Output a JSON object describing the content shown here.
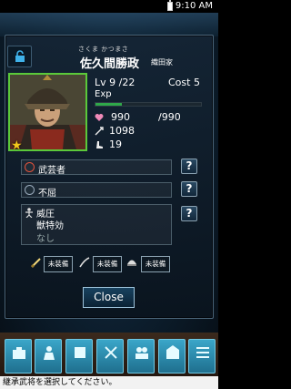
{
  "status_bar": {
    "time": "9:10 AM"
  },
  "general": {
    "furigana": "さくま かつまさ",
    "name": "佐久間勝政",
    "clan": "織田家",
    "level_label": "Lv 9  /22",
    "cost_label": "Cost 5",
    "exp_label": "Exp",
    "exp_progress": 0.25,
    "hp": "990",
    "hp_max": "/990",
    "attack": "1098",
    "speed": "19",
    "rarity_icon": "gold-star"
  },
  "skills": [
    {
      "label": "武芸者",
      "icon": "red-star-icon"
    },
    {
      "label": "不屈",
      "icon": "star-badge-icon"
    }
  ],
  "ability": {
    "title": "威圧",
    "subtitle": "獣特効",
    "note": "なし"
  },
  "help_label": "?",
  "equipment": [
    {
      "label": "未装備",
      "icon": "sword-icon"
    },
    {
      "label": "未装備",
      "icon": "blade-icon"
    },
    {
      "label": "未装備",
      "icon": "helmet-icon"
    }
  ],
  "close_label": "Close",
  "nav": [
    "",
    "",
    "",
    "",
    "",
    "",
    ""
  ],
  "hint": "継承武将を選択してください。",
  "colors": {
    "accent": "#5bc93a",
    "panel": "#0f1f2e",
    "button": "#1f6f8e"
  }
}
